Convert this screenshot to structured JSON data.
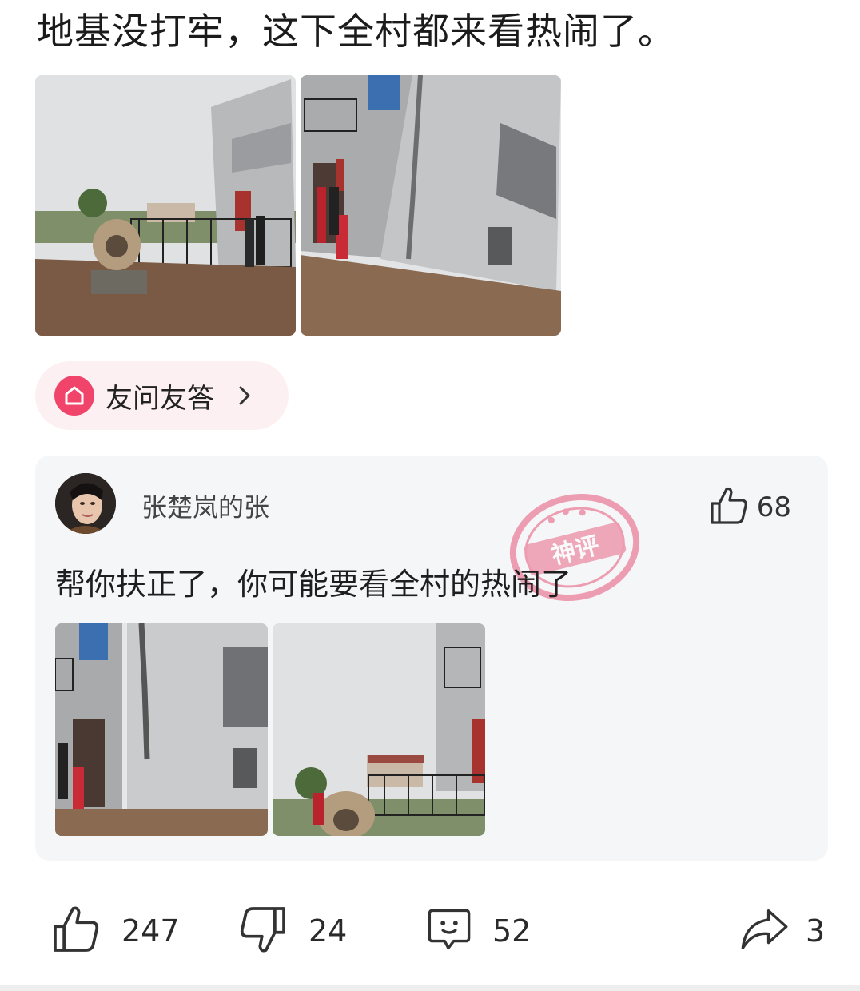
{
  "post": {
    "title": "地基没打牢，这下全村都来看热闹了。"
  },
  "qa": {
    "label": "友问友答",
    "icon": "house-icon",
    "chevron": "chevron-right-icon"
  },
  "comment": {
    "username": "张楚岚的张",
    "likes": "68",
    "text": "帮你扶正了，你可能要看全村的热闹了",
    "badge": "神评"
  },
  "actions": {
    "like_count": "247",
    "dislike_count": "24",
    "comment_count": "52",
    "share_count": "3"
  },
  "colors": {
    "accent": "#f0446a",
    "card_bg": "#f5f6f8",
    "pill_bg": "#fdf0f2",
    "badge": "#e8567a"
  }
}
